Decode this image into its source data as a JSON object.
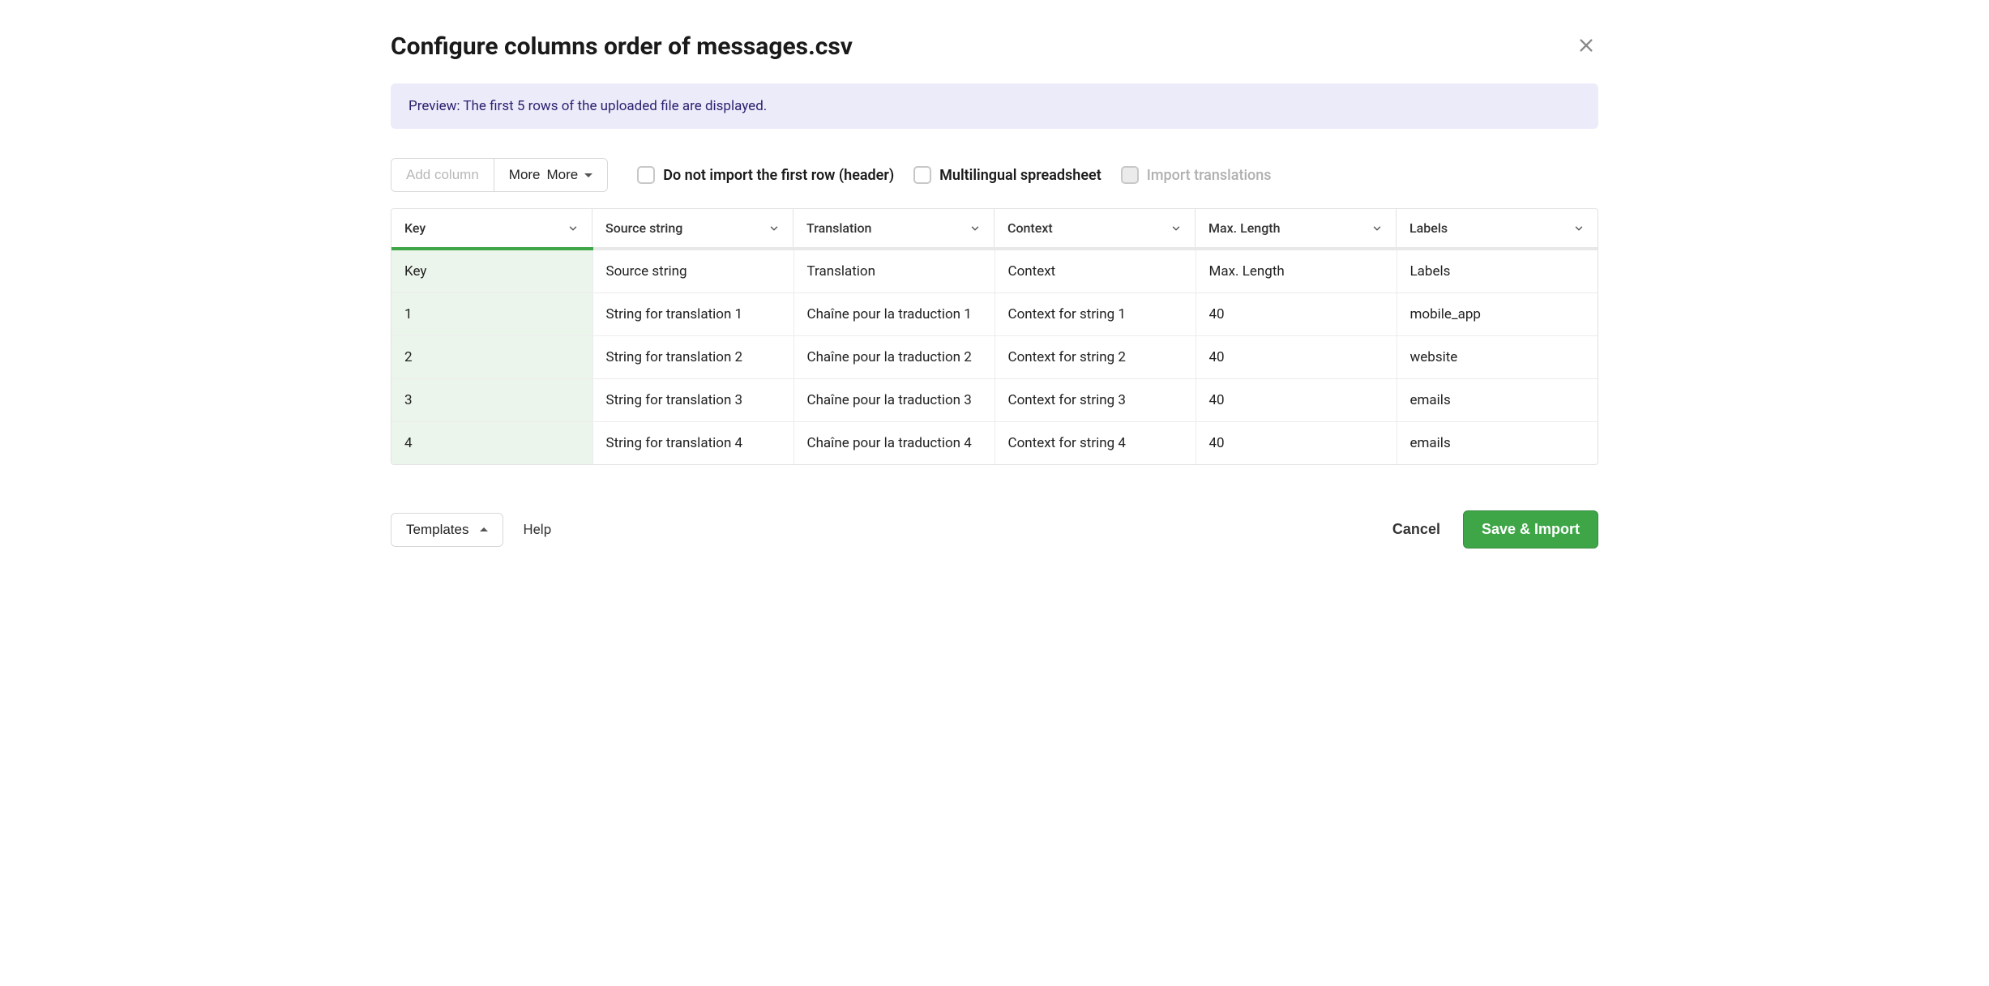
{
  "title": "Configure columns order of messages.csv",
  "banner": "Preview: The first 5 rows of the uploaded file are displayed.",
  "toolbar": {
    "add_column": "Add column",
    "more": "More",
    "do_not_import_first_row": "Do not import the first row (header)",
    "multilingual": "Multilingual spreadsheet",
    "import_translations": "Import translations"
  },
  "columns": [
    {
      "label": "Key",
      "key": true
    },
    {
      "label": "Source string",
      "key": false
    },
    {
      "label": "Translation",
      "key": false
    },
    {
      "label": "Context",
      "key": false
    },
    {
      "label": "Max. Length",
      "key": false
    },
    {
      "label": "Labels",
      "key": false
    }
  ],
  "rows": [
    [
      "Key",
      "Source string",
      "Translation",
      "Context",
      "Max. Length",
      "Labels"
    ],
    [
      "1",
      "String for translation 1",
      "Chaîne pour la traduction 1",
      "Context for string 1",
      "40",
      "mobile_app"
    ],
    [
      "2",
      "String for translation 2",
      "Chaîne pour la traduction 2",
      "Context for string 2",
      "40",
      "website"
    ],
    [
      "3",
      "String for translation 3",
      "Chaîne pour la traduction 3",
      "Context for string 3",
      "40",
      "emails"
    ],
    [
      "4",
      "String for translation 4",
      "Chaîne pour la traduction 4",
      "Context for string 4",
      "40",
      "emails"
    ]
  ],
  "footer": {
    "templates": "Templates",
    "help": "Help",
    "cancel": "Cancel",
    "save": "Save & Import"
  }
}
